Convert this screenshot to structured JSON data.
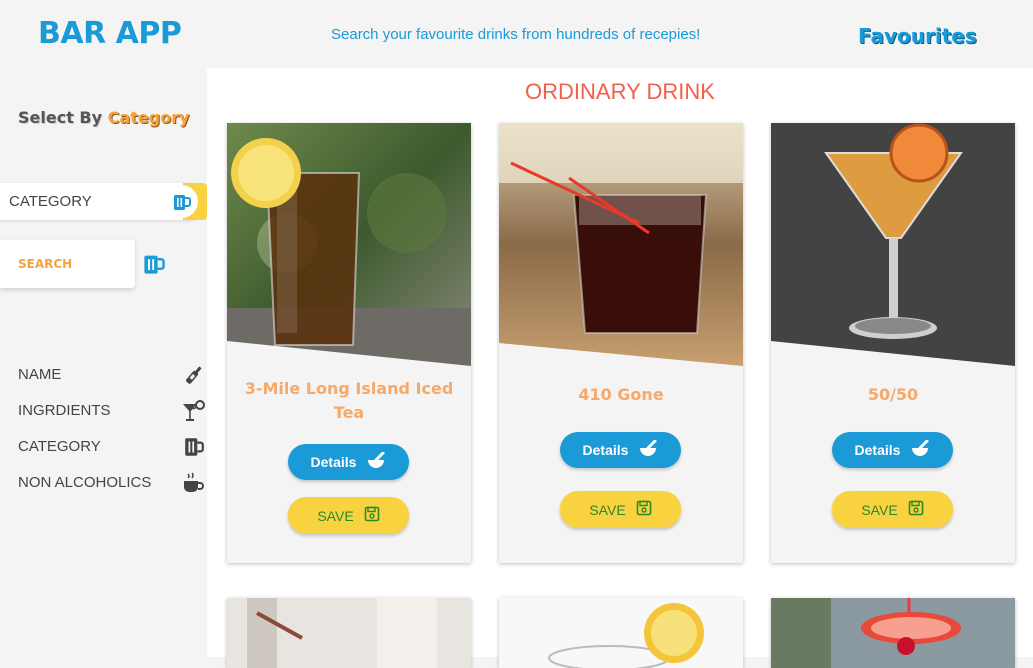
{
  "header": {
    "logo": "BAR APP",
    "tagline": "Search your favourite drinks from hundreds of recepies!",
    "favourites_link": "Favourites"
  },
  "sidebar": {
    "select_title_prefix": "Select By",
    "select_title_accent": "Category",
    "category_tab_label": "CATEGORY",
    "search_tab_label": "SEARCH",
    "menu": [
      {
        "label": "NAME",
        "icon": "bottle-icon"
      },
      {
        "label": "INGRDIENTS",
        "icon": "cocktail-stir-icon"
      },
      {
        "label": "CATEGORY",
        "icon": "beer-mug-icon"
      },
      {
        "label": "NON ALCOHOLICS",
        "icon": "coffee-cup-icon"
      }
    ]
  },
  "main": {
    "section_title": "ORDINARY DRINK",
    "cards": [
      {
        "name": "3-Mile Long Island Iced Tea",
        "details_label": "Details",
        "save_label": "SAVE"
      },
      {
        "name": "410 Gone",
        "details_label": "Details",
        "save_label": "SAVE"
      },
      {
        "name": "50/50",
        "details_label": "Details",
        "save_label": "SAVE"
      }
    ]
  },
  "colors": {
    "brand_blue": "#1a9ad6",
    "accent_orange": "#f7a33a",
    "title_red": "#f0604a",
    "save_yellow": "#f9d33f",
    "save_green": "#2a8a2a"
  }
}
